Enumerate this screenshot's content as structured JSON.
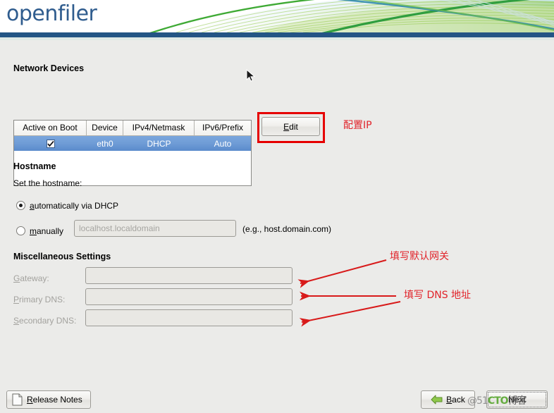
{
  "app": {
    "logo_text": "openfiler"
  },
  "network_devices": {
    "title": "Network Devices",
    "columns": [
      "Active on Boot",
      "Device",
      "IPv4/Netmask",
      "IPv6/Prefix"
    ],
    "rows": [
      {
        "active_on_boot": true,
        "device": "eth0",
        "ipv4": "DHCP",
        "ipv6": "Auto",
        "selected": true
      }
    ],
    "edit_button": "Edit"
  },
  "hostname": {
    "title": "Hostname",
    "prompt": "Set the hostname:",
    "option_auto": "automatically via DHCP",
    "option_auto_selected": true,
    "option_manual": "manually",
    "option_manual_selected": false,
    "manual_placeholder": "localhost.localdomain",
    "manual_value": "",
    "example": "(e.g., host.domain.com)"
  },
  "misc": {
    "title": "Miscellaneous Settings",
    "fields": [
      {
        "label": "Gateway:",
        "value": "",
        "disabled": true
      },
      {
        "label": "Primary DNS:",
        "value": "",
        "disabled": true
      },
      {
        "label": "Secondary DNS:",
        "value": "",
        "disabled": true
      }
    ]
  },
  "footer": {
    "release_notes": "Release Notes",
    "back": "Back",
    "next": "Next"
  },
  "annotations": {
    "config_ip": "配置IP",
    "gateway_note": "填写默认网关",
    "dns_note": "填写 DNS 地址"
  },
  "watermark": {
    "prefix": "@51",
    "brand": "CTO",
    "suffix": "博客"
  },
  "colors": {
    "banner_blue": "#235585",
    "logo_blue": "#2f5c8e",
    "row_select_blue": "#6f9cd6",
    "annotation_red": "#e1232a",
    "body_grey": "#ebebe9"
  }
}
